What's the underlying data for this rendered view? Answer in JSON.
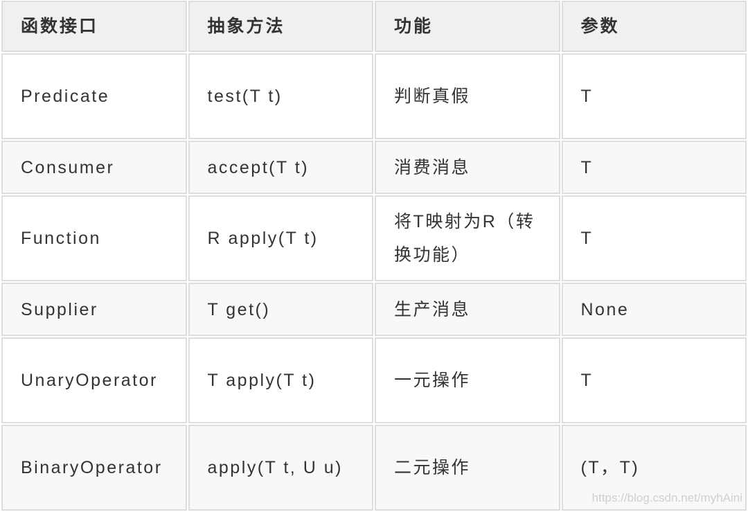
{
  "table": {
    "headers": [
      "函数接口",
      "抽象方法",
      "功能",
      "参数"
    ],
    "rows": [
      {
        "interface": "Predicate",
        "method": "test(T t)",
        "function": "判断真假",
        "params": "T"
      },
      {
        "interface": "Consumer",
        "method": "accept(T t)",
        "function": "消费消息",
        "params": "T"
      },
      {
        "interface": "Function",
        "method": "R apply(T t)",
        "function": "将T映射为R（转换功能）",
        "params": "T"
      },
      {
        "interface": "Supplier",
        "method": "T get()",
        "function": "生产消息",
        "params": "None"
      },
      {
        "interface": "UnaryOperator",
        "method": "T apply(T t)",
        "function": "一元操作",
        "params": "T"
      },
      {
        "interface": "BinaryOperator",
        "method": "apply(T t, U u)",
        "function": "二元操作",
        "params": "(T，T)"
      }
    ]
  },
  "watermark": "https://blog.csdn.net/myhAini"
}
